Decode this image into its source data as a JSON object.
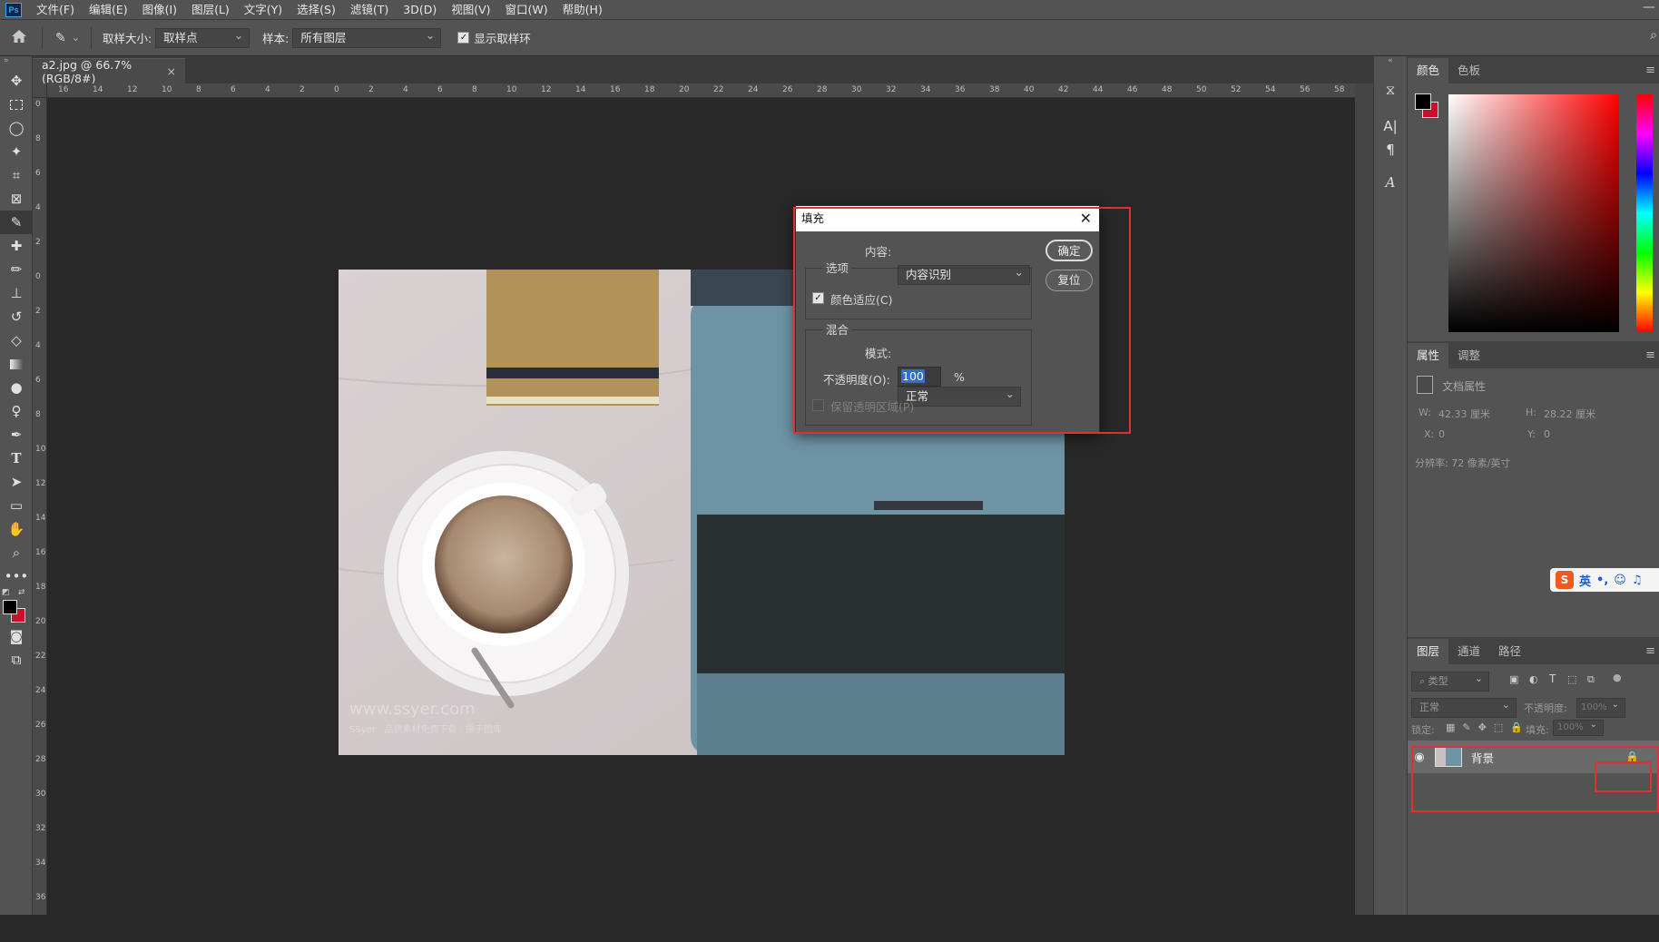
{
  "app": {
    "logo": "Ps"
  },
  "menu": [
    "文件(F)",
    "编辑(E)",
    "图像(I)",
    "图层(L)",
    "文字(Y)",
    "选择(S)",
    "滤镜(T)",
    "3D(D)",
    "视图(V)",
    "窗口(W)",
    "帮助(H)"
  ],
  "options": {
    "sample_size_label": "取样大小:",
    "sample_size_value": "取样点",
    "sample_label": "样本:",
    "sample_value": "所有图层",
    "show_ring_label": "显示取样环"
  },
  "document": {
    "tab_title": "a2.jpg @ 66.7%(RGB/8#)",
    "close": "×"
  },
  "ruler_h": [
    "16",
    "14",
    "12",
    "10",
    "8",
    "6",
    "4",
    "2",
    "0",
    "2",
    "4",
    "6",
    "8",
    "10",
    "12",
    "14",
    "16",
    "18",
    "20",
    "22",
    "24",
    "26",
    "28",
    "30",
    "32",
    "34",
    "36",
    "38",
    "40",
    "42",
    "44",
    "46",
    "48",
    "50",
    "52",
    "54",
    "56",
    "58"
  ],
  "ruler_v": [
    "0",
    "8",
    "6",
    "4",
    "2",
    "0",
    "2",
    "4",
    "6",
    "8",
    "10",
    "12",
    "14",
    "16",
    "18",
    "20",
    "22",
    "24",
    "26",
    "28",
    "30",
    "32",
    "34",
    "36"
  ],
  "photo": {
    "watermark": "www.ssyer.com",
    "watermark_sub": "SSyer · 品质素材免费下载 · 摄于图库"
  },
  "dialog": {
    "title": "填充",
    "content_label": "内容:",
    "content_value": "内容识别",
    "options_group": "选项",
    "color_adapt_label": "颜色适应(C)",
    "blend_group": "混合",
    "mode_label": "模式:",
    "mode_value": "正常",
    "opacity_label": "不透明度(O):",
    "opacity_value": "100",
    "opacity_unit": "%",
    "preserve_label": "保留透明区域(P)",
    "ok": "确定",
    "reset": "复位"
  },
  "color_panel": {
    "tabs": [
      "颜色",
      "色板"
    ],
    "fg": "#000000",
    "bg": "#c8102e"
  },
  "properties_panel": {
    "tabs": [
      "属性",
      "调整"
    ],
    "doc_props": "文档属性",
    "w_label": "W:",
    "w_value": "42.33 厘米",
    "h_label": "H:",
    "h_value": "28.22 厘米",
    "x_label": "X:",
    "x_value": "0",
    "y_label": "Y:",
    "y_value": "0",
    "resolution": "分辨率: 72 像素/英寸"
  },
  "ime": {
    "lang": "英",
    "punct": "•,",
    "emoji": "☺",
    "mic": "🎤"
  },
  "layers_panel": {
    "tabs": [
      "图层",
      "通道",
      "路径"
    ],
    "filter_kind": "类型",
    "blend_mode": "正常",
    "opacity_label": "不透明度:",
    "opacity_value": "100%",
    "lock_label": "锁定:",
    "fill_label": "填充:",
    "fill_value": "100%",
    "layer_name": "背景"
  },
  "colors": {
    "accent_red": "#e03030",
    "panel": "#535353",
    "canvas": "#282828"
  }
}
